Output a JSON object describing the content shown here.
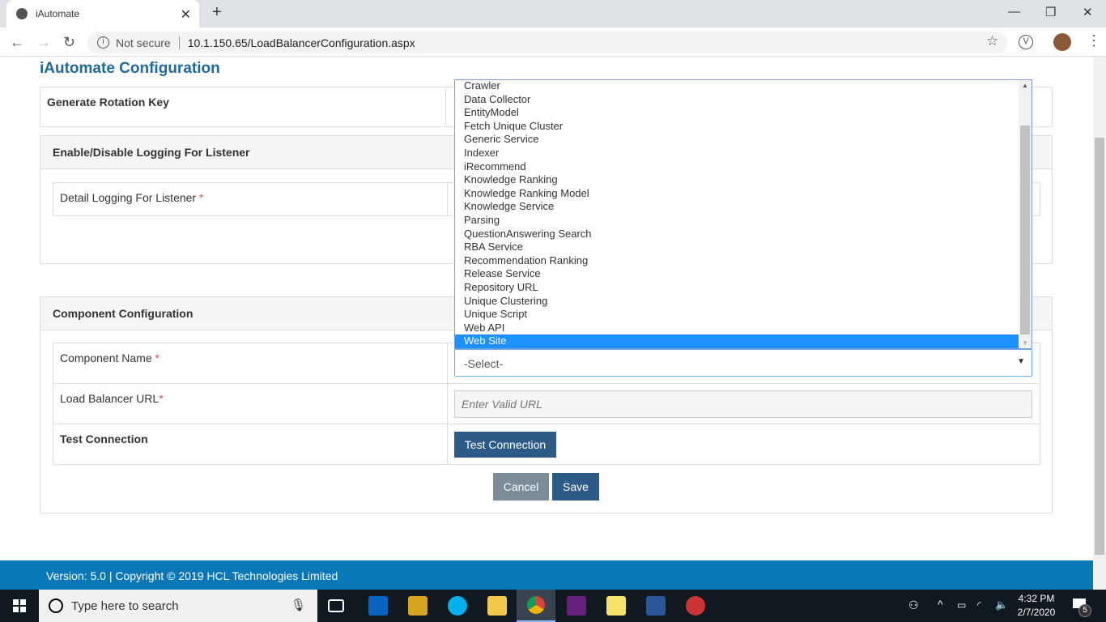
{
  "browser": {
    "tab_title": "iAutomate",
    "security": "Not secure",
    "url": "10.1.150.65/LoadBalancerConfiguration.aspx"
  },
  "page": {
    "title": "iAutomate Configuration",
    "rotation": {
      "label": "Generate Rotation Key"
    },
    "logging": {
      "header": "Enable/Disable Logging For Listener",
      "label": "Detail Logging For Listener",
      "req": "*"
    },
    "component": {
      "header": "Component Configuration",
      "name_label": "Component Name",
      "req": "*",
      "name_value": "-Select-",
      "url_label": "Load Balancer URL",
      "url_placeholder": "Enter Valid URL",
      "test_label": "Test Connection",
      "test_button": "Test Connection",
      "cancel": "Cancel",
      "save": "Save"
    },
    "dropdown_options": [
      "Crawler",
      "Data Collector",
      "EntityModel",
      "Fetch Unique Cluster",
      "Generic Service",
      "Indexer",
      "iRecommend",
      "Knowledge Ranking",
      "Knowledge Ranking Model",
      "Knowledge Service",
      "Parsing",
      "QuestionAnswering Search",
      "RBA Service",
      "Recommendation Ranking",
      "Release Service",
      "Repository URL",
      "Unique Clustering",
      "Unique Script",
      "Web API",
      "Web Site"
    ],
    "selected_option": "Web Site"
  },
  "footer": {
    "text": "Version: 5.0 | Copyright © 2019 HCL Technologies Limited"
  },
  "taskbar": {
    "search_placeholder": "Type here to search",
    "time": "4:32 PM",
    "date": "2/7/2020",
    "notifications": "5"
  }
}
